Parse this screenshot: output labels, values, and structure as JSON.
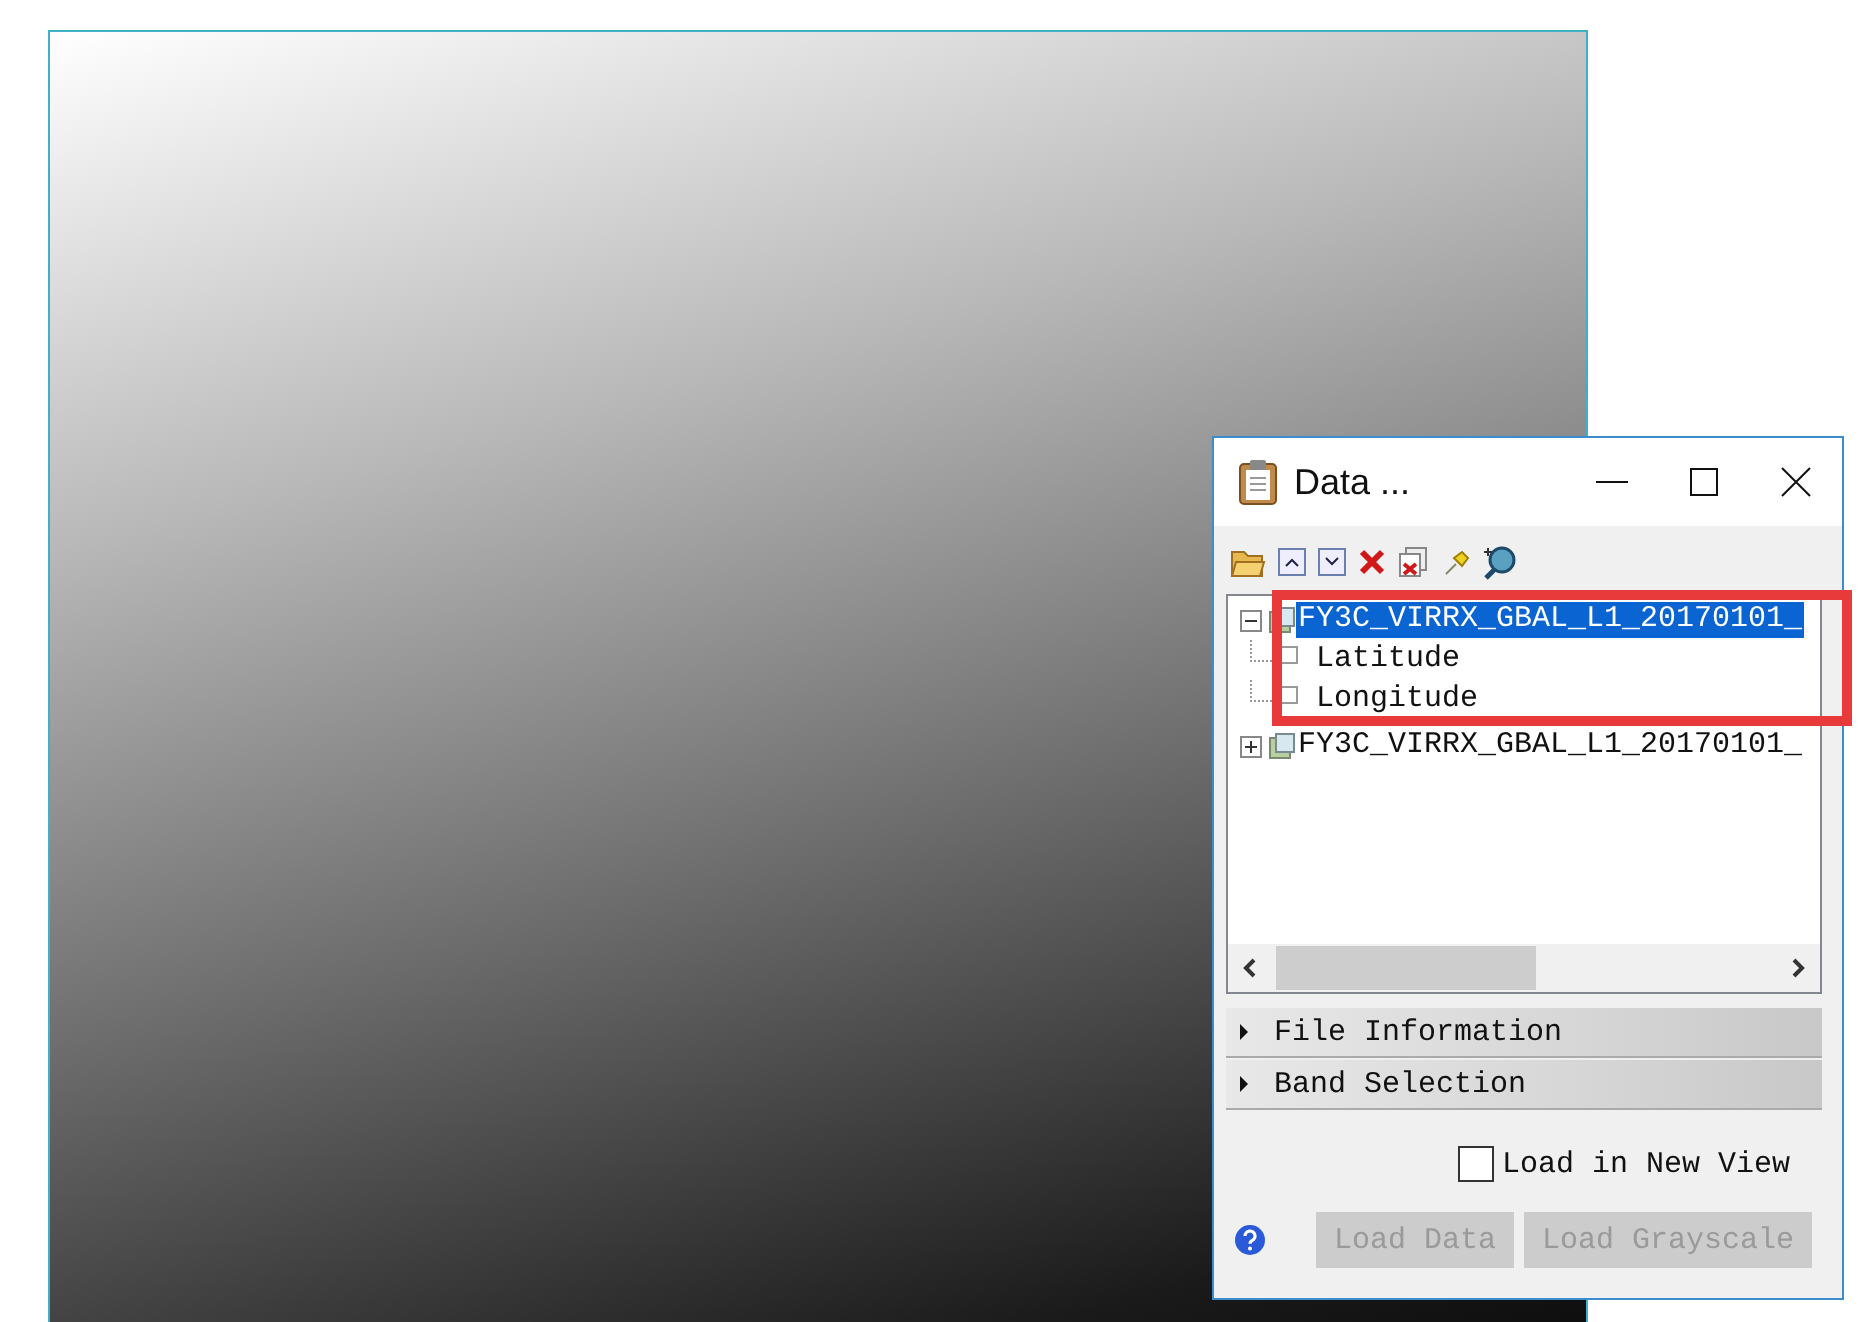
{
  "image_view": {
    "kind": "grayscale"
  },
  "dialog": {
    "title": "Data ...",
    "toolbar": [
      {
        "kind": "open"
      },
      {
        "kind": "up"
      },
      {
        "kind": "down"
      },
      {
        "kind": "remove"
      },
      {
        "kind": "remove-all"
      },
      {
        "kind": "pin"
      },
      {
        "kind": "search"
      }
    ],
    "tree": [
      {
        "label": "FY3C_VIRRX_GBAL_L1_20170101_",
        "expanded": true,
        "selected": true,
        "children": [
          {
            "label": "Latitude",
            "selected": false
          },
          {
            "label": "Longitude",
            "selected": false
          }
        ]
      },
      {
        "label": "FY3C_VIRRX_GBAL_L1_20170101_",
        "expanded": false,
        "selected": false
      }
    ],
    "sections": [
      {
        "label": "File Information",
        "expanded": false
      },
      {
        "label": "Band Selection",
        "expanded": false
      }
    ],
    "load_in_new_view": {
      "label": "Load in New View",
      "checked": false
    },
    "buttons": [
      {
        "label": "Load Data",
        "disabled": true
      },
      {
        "label": "Load Grayscale",
        "disabled": true
      }
    ]
  },
  "highlight": {
    "kind": "box"
  }
}
